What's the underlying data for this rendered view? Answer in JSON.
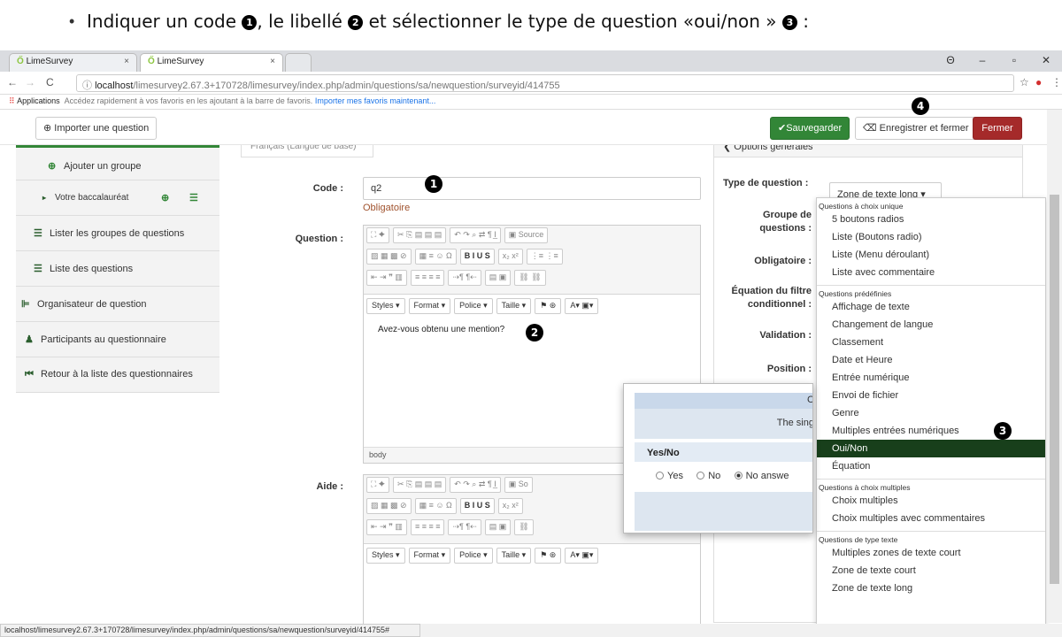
{
  "instruction": {
    "bullet": "•",
    "part1": "Indiquer un code ",
    "n1": "1",
    "part2": ", le libellé ",
    "n2": "2",
    "part3": " et sélectionner le type de question «oui/non » ",
    "n3": "3",
    "part4": " :"
  },
  "browser": {
    "tabs": [
      {
        "label": "LimeSurvey"
      },
      {
        "label": "LimeSurvey"
      }
    ],
    "tab_close": "×",
    "url_host": "localhost",
    "url_path": "/limesurvey2.67.3+170728/limesurvey/index.php/admin/questions/sa/newquestion/surveyid/414755",
    "bookmarks_apps": "Applications",
    "bookmarks_hint": "Accédez rapidement à vos favoris en les ajoutant à la barre de favoris.",
    "bookmarks_link": "Importer mes favoris maintenant...",
    "status_url": "localhost/limesurvey2.67.3+170728/limesurvey/index.php/admin/questions/sa/newquestion/surveyid/414755#"
  },
  "toolbar": {
    "import_label": "Importer une question",
    "save_label": "Sauvegarder",
    "save_close_label": "Enregistrer et fermer",
    "close_label": "Fermer",
    "marker4": "4"
  },
  "sidebar": {
    "items": [
      {
        "label": "Ajouter un groupe"
      },
      {
        "label": "Votre baccalauréat"
      },
      {
        "label": "Lister les groupes de questions"
      },
      {
        "label": "Liste des questions"
      },
      {
        "label": "Organisateur de question"
      },
      {
        "label": "Participants au questionnaire"
      },
      {
        "label": "Retour à la liste des questionnaires"
      }
    ]
  },
  "form": {
    "lang_tab": "Français (Langue de base)",
    "code_label": "Code :",
    "code_value": "q2",
    "required_note": "Obligatoire",
    "question_label": "Question :",
    "question_text": "Avez-vous obtenu une mention?",
    "help_label": "Aide :",
    "editor_footer": "body",
    "source_label": "Source",
    "styles": "Styles",
    "format": "Format",
    "police": "Police",
    "taille": "Taille",
    "marker1": "1",
    "marker2": "2"
  },
  "right_panel": {
    "header": "Options générales",
    "type_label": "Type de question :",
    "type_value": "Zone de texte long",
    "group_label": "Groupe de questions :",
    "mandatory_label": "Obligatoire :",
    "filter_label": "Équation du filtre conditionnel :",
    "validation_label": "Validation :",
    "position_label": "Position :"
  },
  "question_types": {
    "groups": [
      {
        "name": "Questions à choix unique",
        "items": [
          "5 boutons radios",
          "Liste (Boutons radio)",
          "Liste (Menu déroulant)",
          "Liste avec commentaire"
        ]
      },
      {
        "name": "Questions prédéfinies",
        "items": [
          "Affichage de texte",
          "Changement de langue",
          "Classement",
          "Date et Heure",
          "Entrée numérique",
          "Envoi de fichier",
          "Genre",
          "Multiples entrées numériques",
          "Oui/Non",
          "Équation"
        ]
      },
      {
        "name": "Questions à choix multiples",
        "items": [
          "Choix multiples",
          "Choix multiples avec commentaires"
        ]
      },
      {
        "name": "Questions de type texte",
        "items": [
          "Multiples zones de texte court",
          "Zone de texte court",
          "Zone de texte long"
        ]
      }
    ],
    "selected": "Oui/Non",
    "marker3": "3"
  },
  "preview": {
    "header_fragment": "C",
    "description_fragment": "The sing",
    "question_title": "Yes/No",
    "options": [
      "Yes",
      "No",
      "No answe"
    ],
    "selected_option": "No answe"
  }
}
